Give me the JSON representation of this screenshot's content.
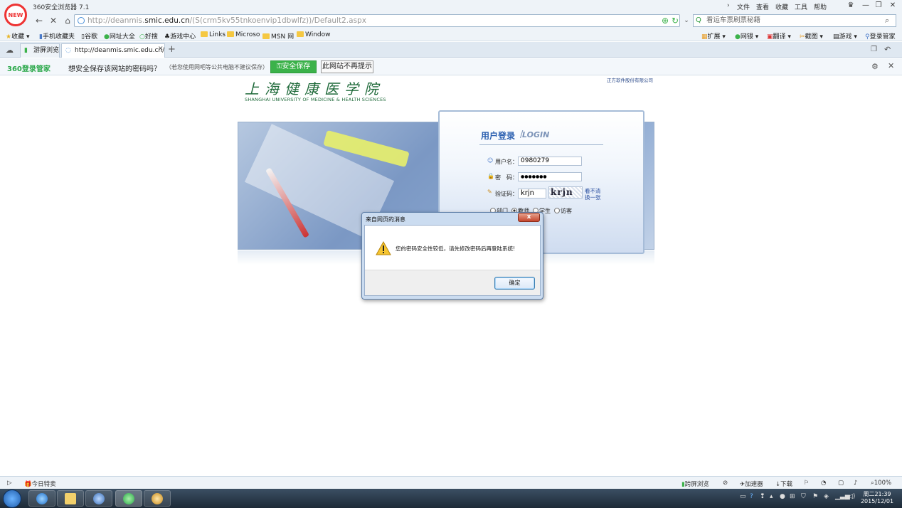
{
  "window": {
    "app_title": "360安全浏览器 7.1",
    "logo_text": "NEW",
    "menu": [
      "文件",
      "查看",
      "收藏",
      "工具",
      "帮助"
    ]
  },
  "address": {
    "url_prefix": "http://deanmis.",
    "url_domain": "smic.edu.cn",
    "url_rest": "/(S(crm5kv55tnkoenvip1dbwlfz))/Default2.aspx",
    "search_placeholder": "看运车票刷票秘籍"
  },
  "bookmarks": {
    "left": [
      "收藏",
      "手机收藏夹",
      "谷歌",
      "网址大全",
      "好搜",
      "游戏中心",
      "Links",
      "Microso",
      "MSN 网",
      "Window"
    ],
    "right": [
      "扩展",
      "网银",
      "翻译",
      "截图",
      "游戏",
      "登录管家"
    ]
  },
  "tabs": {
    "items": [
      "游屏浏览",
      "http://deanmis.smic.edu.cn/("
    ],
    "new_tab": "+"
  },
  "savebar": {
    "brand": "360登录管家",
    "question": "想安全保存该网站的密码吗？",
    "note": "（若您使用网吧等公共电脑不建议保存）",
    "save_label": "安全保存",
    "nosave_label": "此网站不再提示"
  },
  "page": {
    "school_cn": "上海健康医学院",
    "school_en": "SHANGHAI UNIVERSITY OF MEDICINE & HEALTH SCIENCES",
    "vendor": "正方软件股份有限公司",
    "login_title": "用户登录",
    "login_title_en": "LOGIN",
    "username_label": "用户名：",
    "username_value": "0980279",
    "password_label": "密　码：",
    "password_value": "●●●●●●●",
    "captcha_label": "验证码：",
    "captcha_value": "krjn",
    "captcha_image_text": "krjn",
    "refresh_line1": "看不清",
    "refresh_line2": "换一张",
    "roles": [
      "部门",
      "教师",
      "学生",
      "访客"
    ],
    "selected_role": "教师"
  },
  "dialog": {
    "title": "来自网页的消息",
    "close": "x",
    "message": "您的密码安全性较低，请先修改密码后再登陆系统!",
    "ok_label": "确定"
  },
  "statusbar": {
    "left_item": "今日特卖",
    "items": [
      "跨屏浏览",
      "加速器",
      "下载"
    ],
    "zoom": "100%"
  },
  "taskbar": {
    "time": "周二21:39",
    "date": "2015/12/01"
  }
}
